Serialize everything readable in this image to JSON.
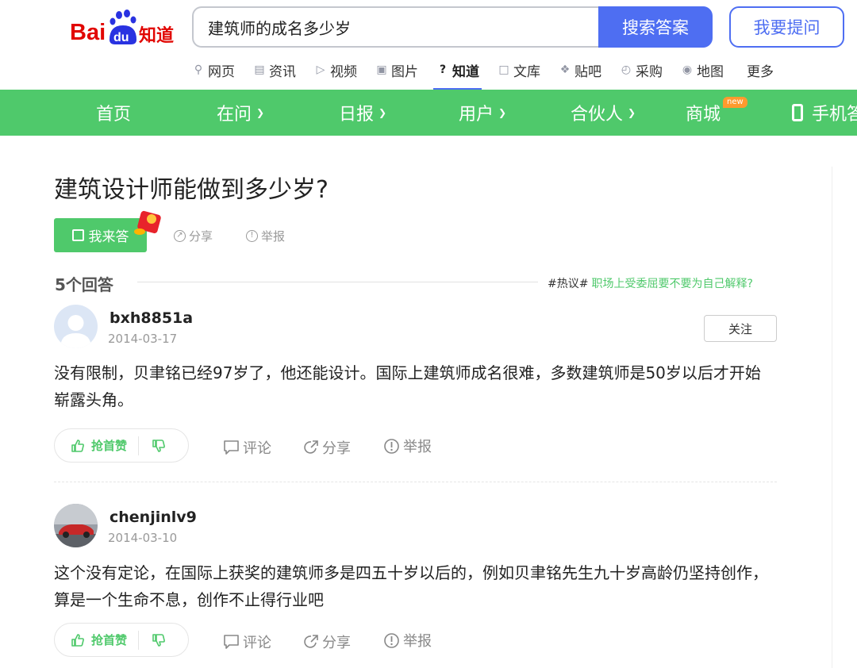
{
  "header": {
    "logo_text": "Bai du 知道",
    "search_value": "建筑师的成名多少岁",
    "search_button": "搜索答案",
    "ask_button": "我要提问"
  },
  "channels": [
    {
      "label": "网页",
      "icon": "search-icon"
    },
    {
      "label": "资讯",
      "icon": "news-icon"
    },
    {
      "label": "视频",
      "icon": "video-icon"
    },
    {
      "label": "图片",
      "icon": "image-icon"
    },
    {
      "label": "知道",
      "icon": "question-icon",
      "active": true
    },
    {
      "label": "文库",
      "icon": "doc-icon"
    },
    {
      "label": "贴吧",
      "icon": "tieba-icon"
    },
    {
      "label": "采购",
      "icon": "cart-icon"
    },
    {
      "label": "地图",
      "icon": "map-icon"
    },
    {
      "label": "更多"
    }
  ],
  "nav": {
    "home": "首页",
    "asking": "在问",
    "daily": "日报",
    "users": "用户",
    "partners": "合伙人",
    "mall": "商城",
    "mall_badge": "new",
    "mobile": "手机答"
  },
  "question": {
    "title": "建筑设计师能做到多少岁?",
    "answer_button": "我来答",
    "share": "分享",
    "report": "举报"
  },
  "answers_header": {
    "count_label": "5个回答",
    "hot_tag": "#热议#",
    "hot_link": "职场上受委屈要不要为自己解释?"
  },
  "answers": [
    {
      "username": "bxh8851a",
      "date": "2014-03-17",
      "follow": "关注",
      "content": "没有限制，贝聿铭已经97岁了，他还能设计。国际上建筑师成名很难，多数建筑师是50岁以后才开始崭露头角。",
      "like": "抢首赞",
      "comment": "评论",
      "share": "分享",
      "report": "举报"
    },
    {
      "username": "chenjinlv9",
      "date": "2014-03-10",
      "content": "这个没有定论，在国际上获奖的建筑师多是四五十岁以后的，例如贝聿铭先生九十岁高龄仍坚持创作，算是一个生命不息，创作不止得行业吧",
      "like": "抢首赞",
      "comment": "评论",
      "share": "分享",
      "report": "举报"
    }
  ],
  "colors": {
    "brand_blue": "#4e6ef2",
    "green": "#4fc96b",
    "logo_red": "#e10602",
    "logo_blue": "#2932e1"
  }
}
